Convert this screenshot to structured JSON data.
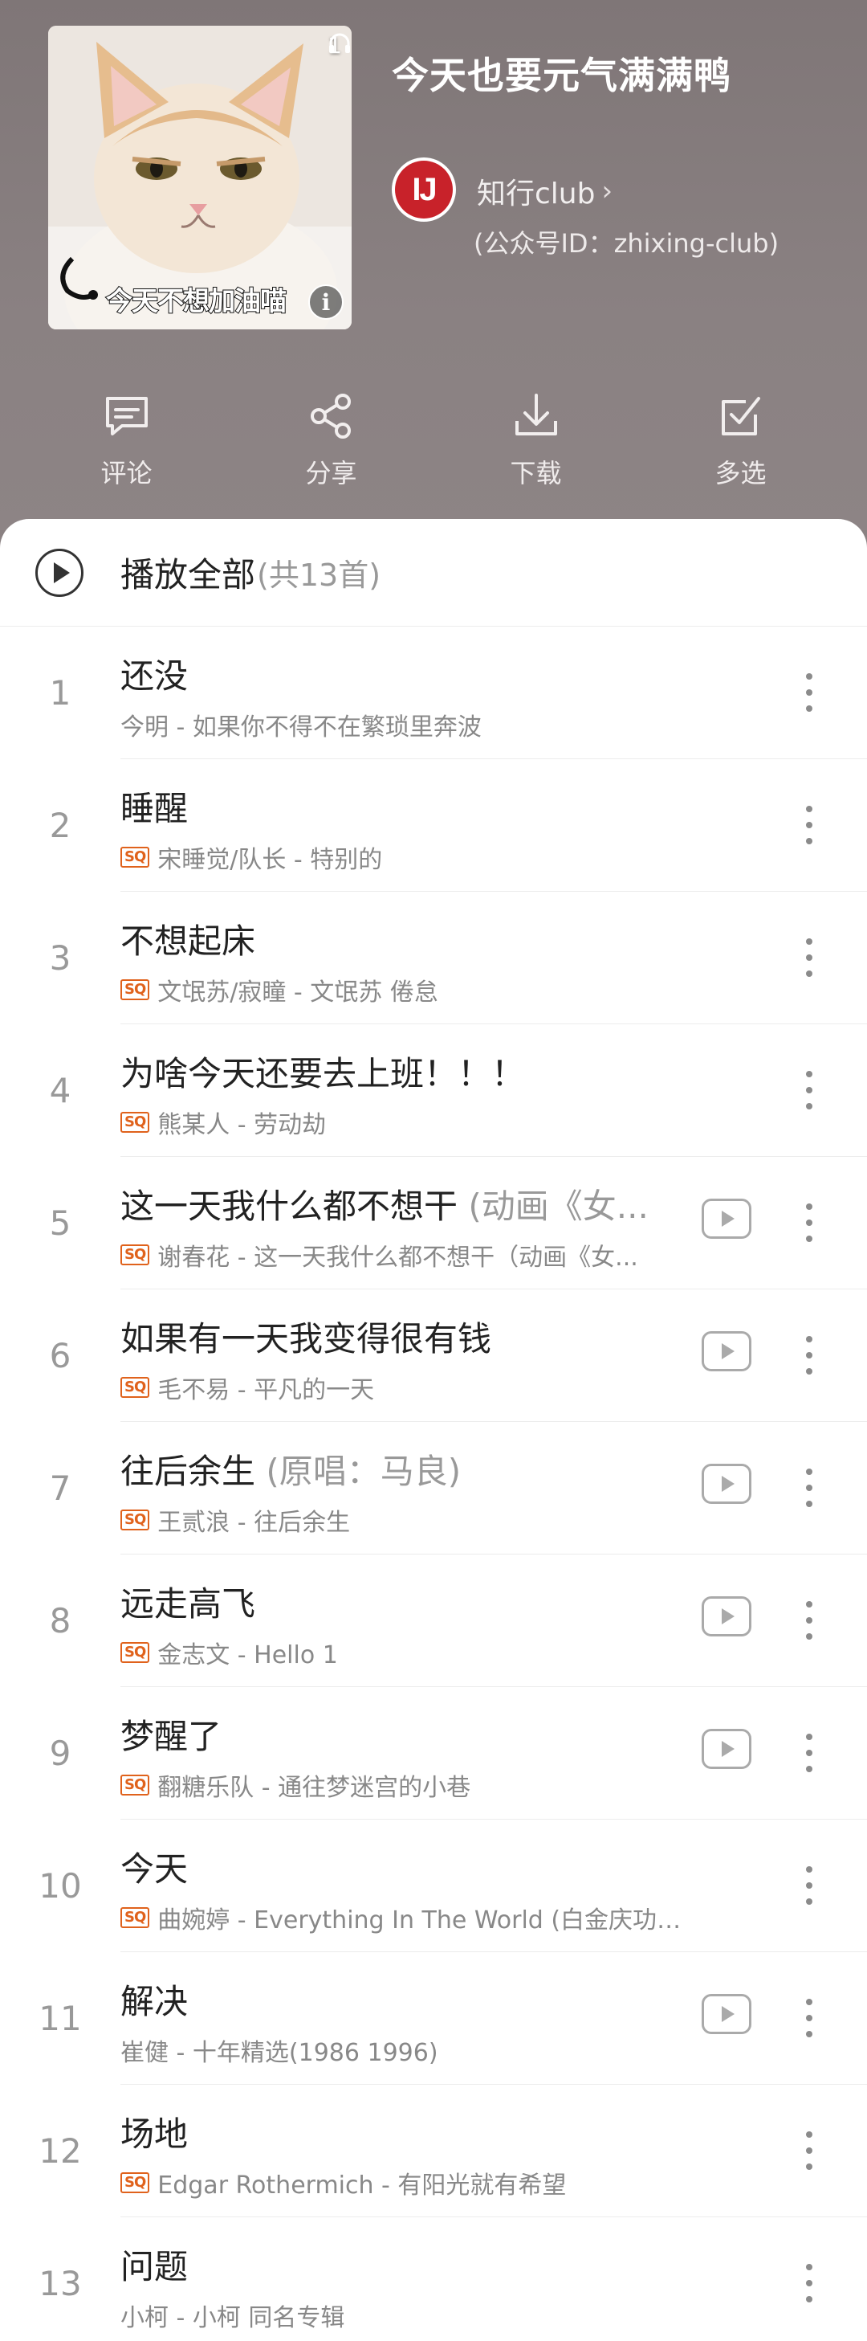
{
  "header": {
    "cover_listen_count": "1",
    "cover_caption": "今天不想加油喵",
    "cover_info_glyph": "i",
    "title": "今天也要元气满满鸭",
    "creator_avatar_text": "IJ",
    "creator_name": "知行club",
    "creator_chevron": "›",
    "creator_sub": "(公众号ID：zhixing-club)"
  },
  "actions": [
    {
      "label": "评论",
      "icon": "comment-icon"
    },
    {
      "label": "分享",
      "icon": "share-icon"
    },
    {
      "label": "下载",
      "icon": "download-icon"
    },
    {
      "label": "多选",
      "icon": "multi-select-icon"
    }
  ],
  "playall": {
    "label": "播放全部",
    "count": "(共13首)"
  },
  "songs": [
    {
      "num": "1",
      "title": "还没",
      "title_sub": "",
      "sq": false,
      "meta": "今明 - 如果你不得不在繁琐里奔波",
      "mv": false
    },
    {
      "num": "2",
      "title": "睡醒",
      "title_sub": "",
      "sq": true,
      "meta": "宋睡觉/队长 - 特别的",
      "mv": false
    },
    {
      "num": "3",
      "title": "不想起床",
      "title_sub": "",
      "sq": true,
      "meta": "文氓苏/寂瞳 - 文氓苏 倦怠",
      "mv": false
    },
    {
      "num": "4",
      "title": "为啥今天还要去上班！！！",
      "title_sub": "",
      "sq": true,
      "meta": "熊某人 - 劳动劫",
      "mv": false
    },
    {
      "num": "5",
      "title": "这一天我什么都不想干 ",
      "title_sub": "(动画《女...",
      "sq": true,
      "meta": "谢春花 - 这一天我什么都不想干（动画《女...",
      "mv": true
    },
    {
      "num": "6",
      "title": "如果有一天我变得很有钱",
      "title_sub": "",
      "sq": true,
      "meta": "毛不易 - 平凡的一天",
      "mv": true
    },
    {
      "num": "7",
      "title": "往后余生 ",
      "title_sub": "(原唱：马良)",
      "sq": true,
      "meta": "王贰浪 - 往后余生",
      "mv": true
    },
    {
      "num": "8",
      "title": "远走高飞",
      "title_sub": "",
      "sq": true,
      "meta": "金志文 - Hello 1",
      "mv": true
    },
    {
      "num": "9",
      "title": "梦醒了",
      "title_sub": "",
      "sq": true,
      "meta": "翻糖乐队 - 通往梦迷宫的小巷",
      "mv": true
    },
    {
      "num": "10",
      "title": "今天",
      "title_sub": "",
      "sq": true,
      "meta": "曲婉婷 - Everything In The World (白金庆功版)",
      "mv": false
    },
    {
      "num": "11",
      "title": "解决",
      "title_sub": "",
      "sq": false,
      "meta": "崔健 - 十年精选(1986 1996)",
      "mv": true
    },
    {
      "num": "12",
      "title": "场地",
      "title_sub": "",
      "sq": true,
      "meta": "Edgar Rothermich - 有阳光就有希望",
      "mv": false
    },
    {
      "num": "13",
      "title": "问题",
      "title_sub": "",
      "sq": false,
      "meta": "小柯 - 小柯 同名专辑",
      "mv": false
    }
  ],
  "sq_label": "SQ",
  "colors": {
    "header_bg": "#8a8182",
    "sq_badge": "#e0621c",
    "text_muted": "#999999"
  }
}
